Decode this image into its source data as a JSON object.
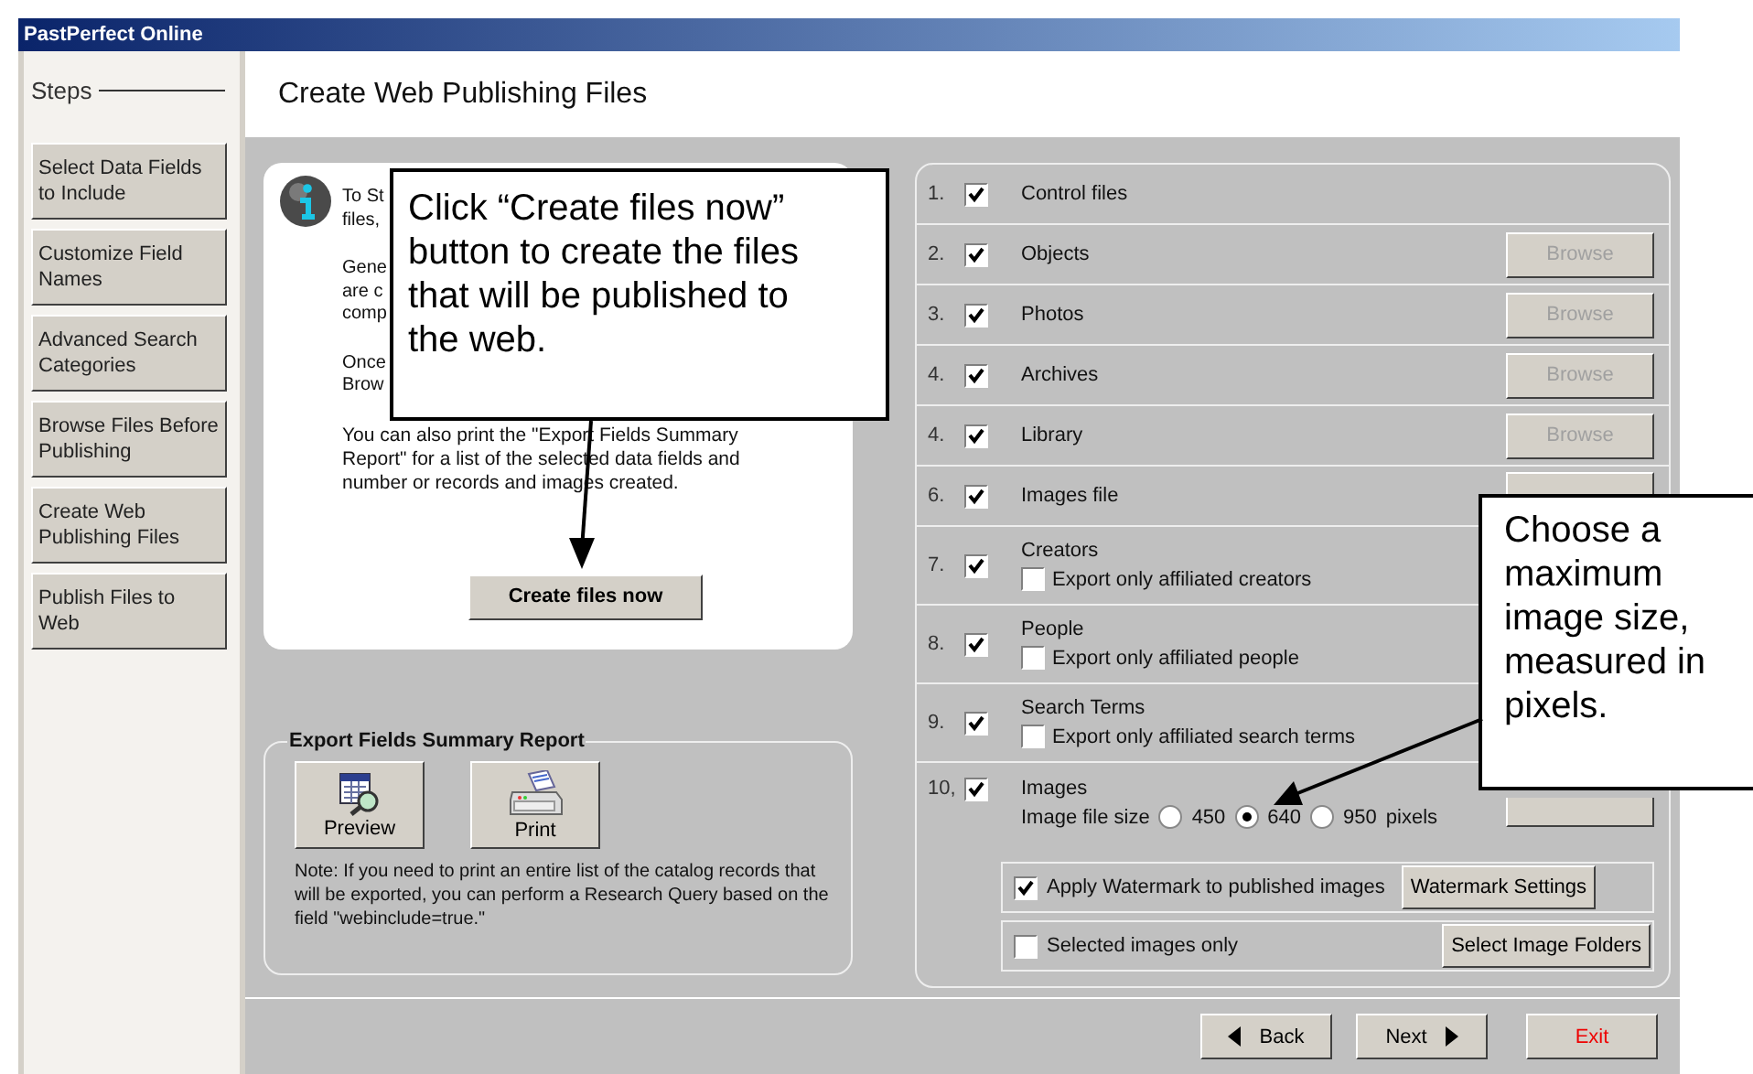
{
  "window": {
    "title": "PastPerfect Online"
  },
  "sidebar": {
    "heading": "Steps",
    "items": [
      {
        "label": "Select Data Fields to Include"
      },
      {
        "label": "Customize Field Names"
      },
      {
        "label": "Advanced Search Categories"
      },
      {
        "label": "Browse Files Before Publishing"
      },
      {
        "label": "Create Web Publishing Files"
      },
      {
        "label": "Publish Files to Web"
      }
    ]
  },
  "page_title": "Create Web Publishing Files",
  "info": {
    "fragments": [
      [
        "To St",
        "files,"
      ],
      [
        "Gene",
        "are c",
        "comp"
      ],
      [
        "Once",
        "Brow"
      ]
    ],
    "paragraph": "You can also print the \"Export Fields Summary Report\" for a list of the selected data fields and number or records and images created.",
    "button": "Create files now"
  },
  "export_report": {
    "title": "Export Fields Summary Report",
    "buttons": [
      {
        "label": "Preview",
        "kind": "preview"
      },
      {
        "label": "Print",
        "kind": "print"
      }
    ],
    "note": "Note: If you need to print an entire list of the catalog records that will be exported, you can perform a Research Query based on the field \"webinclude=true.\""
  },
  "export_items": [
    {
      "number": "1.",
      "checked": true,
      "label": "Control files",
      "kind": "simple"
    },
    {
      "number": "2.",
      "checked": true,
      "label": "Objects",
      "kind": "simple",
      "browse": {
        "label": "Browse",
        "disabled": true
      }
    },
    {
      "number": "3.",
      "checked": true,
      "label": "Photos",
      "kind": "simple",
      "browse": {
        "label": "Browse",
        "disabled": true
      }
    },
    {
      "number": "4.",
      "checked": true,
      "label": "Archives",
      "kind": "simple",
      "browse": {
        "label": "Browse",
        "disabled": true
      }
    },
    {
      "number": "4.",
      "checked": true,
      "label": "Library",
      "kind": "simple",
      "browse": {
        "label": "Browse",
        "disabled": true
      }
    },
    {
      "number": "6.",
      "checked": true,
      "label": "Images file",
      "kind": "simple",
      "browse_covered": true
    },
    {
      "number": "7.",
      "checked": true,
      "label": "Creators",
      "kind": "option",
      "option": {
        "label": "Export only affiliated creators",
        "checked": false
      }
    },
    {
      "number": "8.",
      "checked": true,
      "label": "People",
      "kind": "option",
      "option": {
        "label": "Export only affiliated people",
        "checked": false
      }
    },
    {
      "number": "9.",
      "checked": true,
      "label": "Search Terms",
      "kind": "option",
      "option": {
        "label": "Export only affiliated search terms",
        "checked": false
      }
    },
    {
      "number": "10,",
      "checked": true,
      "label": "Images",
      "kind": "images",
      "browse_covered": true,
      "size_label": "Image file size",
      "sizes": [
        {
          "label": "450",
          "selected": false
        },
        {
          "label": "640",
          "selected": true
        },
        {
          "label": "950",
          "selected": false
        }
      ],
      "unit": "pixels",
      "watermark": {
        "label": "Apply Watermark to published images",
        "checked": true,
        "button": "Watermark Settings"
      },
      "selected_only": {
        "label": "Selected images only",
        "checked": false,
        "button": "Select Image Folders"
      }
    }
  ],
  "nav": [
    {
      "label": "Back",
      "kind": "back"
    },
    {
      "label": "Next",
      "kind": "next"
    },
    {
      "label": "Exit",
      "kind": "exit"
    }
  ],
  "callouts": [
    {
      "text": "Click “Create files now” button to create the files that will be published to the web."
    },
    {
      "text": "Choose a maximum image size, measured in pixels."
    }
  ]
}
